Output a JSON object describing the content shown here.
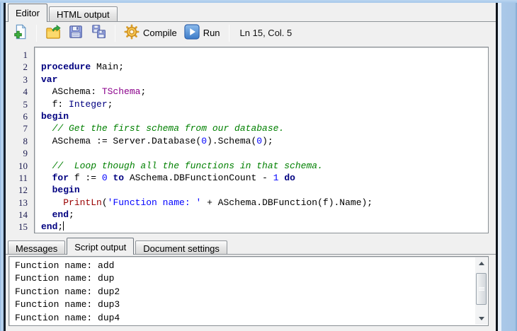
{
  "tabs": {
    "top": [
      {
        "label": "Editor",
        "active": true
      },
      {
        "label": "HTML output",
        "active": false
      }
    ],
    "bottom": [
      {
        "label": "Messages",
        "active": false
      },
      {
        "label": "Script output",
        "active": true
      },
      {
        "label": "Document settings",
        "active": false
      }
    ]
  },
  "toolbar": {
    "compile_label": "Compile",
    "run_label": "Run",
    "status": "Ln 15, Col. 5",
    "icons": [
      "new-document-icon",
      "open-folder-icon",
      "save-icon",
      "save-all-icon",
      "gear-icon",
      "run-play-icon"
    ]
  },
  "editor": {
    "caret": {
      "line": 15,
      "col": 5
    },
    "colors": {
      "keyword": "#000080",
      "comment": "#008000",
      "literal": "#0000ff",
      "type_magenta": "#8b008b",
      "type_navy": "#000080",
      "builtin": "#990000",
      "plain": "#000000",
      "line_number": "#1c1c50"
    },
    "lines": [
      {
        "segs": []
      },
      {
        "segs": [
          [
            "k",
            "procedure"
          ],
          [
            "p",
            " Main;"
          ]
        ]
      },
      {
        "segs": [
          [
            "k",
            "var"
          ]
        ]
      },
      {
        "segs": [
          [
            "p",
            "  ASchema: "
          ],
          [
            "m",
            "TSchema"
          ],
          [
            "p",
            ";"
          ]
        ]
      },
      {
        "segs": [
          [
            "p",
            "  f: "
          ],
          [
            "n",
            "Integer"
          ],
          [
            "p",
            ";"
          ]
        ]
      },
      {
        "segs": [
          [
            "k",
            "begin"
          ]
        ]
      },
      {
        "segs": [
          [
            "c",
            "  // Get the first schema from our database."
          ]
        ]
      },
      {
        "segs": [
          [
            "p",
            "  ASchema := Server.Database("
          ],
          [
            "s",
            "0"
          ],
          [
            "p",
            ").Schema("
          ],
          [
            "s",
            "0"
          ],
          [
            "p",
            ");"
          ]
        ]
      },
      {
        "segs": []
      },
      {
        "segs": [
          [
            "c",
            "  //  Loop though all the functions in that schema."
          ]
        ]
      },
      {
        "segs": [
          [
            "p",
            "  "
          ],
          [
            "k",
            "for"
          ],
          [
            "p",
            " f := "
          ],
          [
            "s",
            "0"
          ],
          [
            "p",
            " "
          ],
          [
            "k",
            "to"
          ],
          [
            "p",
            " ASchema.DBFunctionCount - "
          ],
          [
            "s",
            "1"
          ],
          [
            "p",
            " "
          ],
          [
            "k",
            "do"
          ]
        ]
      },
      {
        "segs": [
          [
            "p",
            "  "
          ],
          [
            "k",
            "begin"
          ]
        ]
      },
      {
        "segs": [
          [
            "p",
            "    "
          ],
          [
            "b",
            "PrintLn"
          ],
          [
            "p",
            "("
          ],
          [
            "s",
            "'Function name: '"
          ],
          [
            "p",
            " + ASchema.DBFunction(f).Name);"
          ]
        ]
      },
      {
        "segs": [
          [
            "p",
            "  "
          ],
          [
            "k",
            "end"
          ],
          [
            "p",
            ";"
          ]
        ]
      },
      {
        "segs": [
          [
            "k",
            "end"
          ],
          [
            "p",
            ";"
          ]
        ],
        "caret": true
      }
    ]
  },
  "output": {
    "lines": [
      "Function name: add",
      "Function name: dup",
      "Function name: dup2",
      "Function name: dup3",
      "Function name: dup4"
    ]
  }
}
